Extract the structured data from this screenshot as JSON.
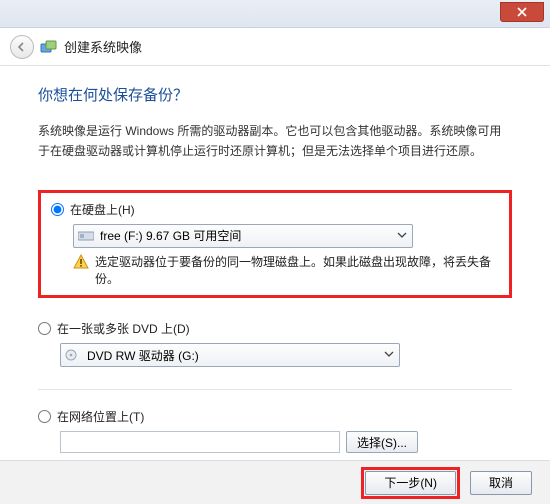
{
  "titlebar": {},
  "header": {
    "app_title": "创建系统映像"
  },
  "main": {
    "heading": "你想在何处保存备份？",
    "description": "系统映像是运行 Windows 所需的驱动器副本。它也可以包含其他驱动器。系统映像可用于在硬盘驱动器或计算机停止运行时还原计算机；但是无法选择单个项目进行还原。",
    "option_hdd": {
      "label": "在硬盘上(H)",
      "combo_text": "free (F:)  9.67 GB 可用空间",
      "warning": "选定驱动器位于要备份的同一物理磁盘上。如果此磁盘出现故障，将丢失备份。"
    },
    "option_dvd": {
      "label": "在一张或多张 DVD 上(D)",
      "combo_text": "DVD RW 驱动器 (G:)"
    },
    "option_net": {
      "label": "在网络位置上(T)",
      "input_value": "",
      "browse_label": "选择(S)..."
    }
  },
  "footer": {
    "next_label": "下一步(N)",
    "cancel_label": "取消"
  }
}
